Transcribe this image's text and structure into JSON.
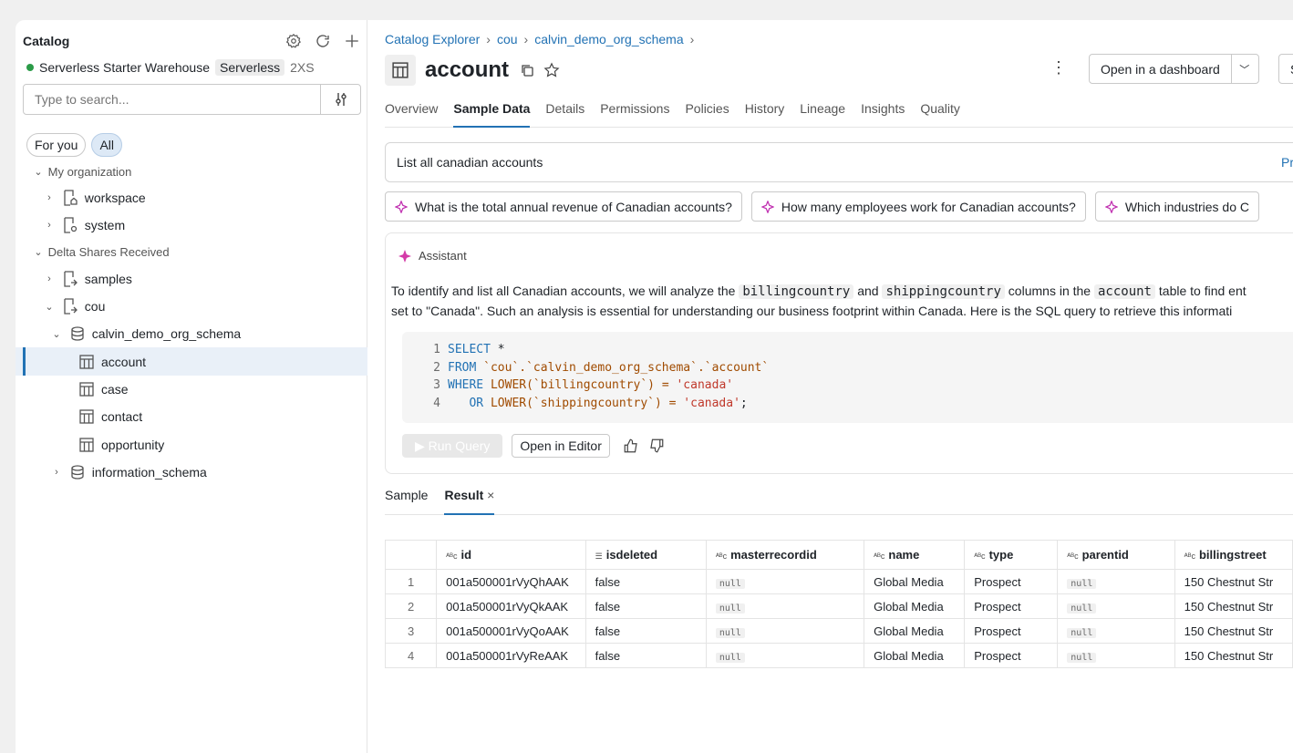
{
  "sidebar": {
    "title": "Catalog",
    "warehouse": {
      "name": "Serverless Starter Warehouse",
      "type_badge": "Serverless",
      "size": "2XS",
      "status_color": "#2b9b48"
    },
    "search_placeholder": "Type to search...",
    "filters": {
      "for_you": "For you",
      "all": "All"
    },
    "tree": {
      "my_org": "My organization",
      "workspace": "workspace",
      "system": "system",
      "delta_shares": "Delta Shares Received",
      "samples": "samples",
      "cou": "cou",
      "schema": "calvin_demo_org_schema",
      "account": "account",
      "case": "case",
      "contact": "contact",
      "opportunity": "opportunity",
      "information_schema": "information_schema"
    }
  },
  "breadcrumb": {
    "items": [
      "Catalog Explorer",
      "cou",
      "calvin_demo_org_schema"
    ],
    "sep": "›"
  },
  "header": {
    "title": "account",
    "dashboard_btn": "Open in a dashboard",
    "cut_btn": "S"
  },
  "tabs": [
    "Overview",
    "Sample Data",
    "Details",
    "Permissions",
    "Policies",
    "History",
    "Lineage",
    "Insights",
    "Quality"
  ],
  "prompt": {
    "text": "List all canadian accounts",
    "right_cut": "Pr"
  },
  "suggestions": [
    "What is the total annual revenue of Canadian accounts?",
    "How many employees work for Canadian accounts?",
    "Which industries do C"
  ],
  "assistant": {
    "label": "Assistant",
    "line1": {
      "a": "To identify and list all Canadian accounts, we will analyze the ",
      "code1": "billingcountry",
      "b": " and ",
      "code2": "shippingcountry",
      "c": " columns in the ",
      "code3": "account",
      "d": " table to find ent"
    },
    "line2": "set to \"Canada\". Such an analysis is essential for understanding our business footprint within Canada. Here is the SQL query to retrieve this informati",
    "code": {
      "l1": {
        "n": "1",
        "kw": "SELECT",
        "rest": " *"
      },
      "l2": {
        "n": "2",
        "kw": "FROM",
        "rest": " `cou`.`calvin_demo_org_schema`.`account`"
      },
      "l3": {
        "n": "3",
        "kw": "WHERE",
        "fn": " LOWER",
        "mid": "(`billingcountry`) = ",
        "str": "'canada'"
      },
      "l4": {
        "n": "4",
        "kw": "   OR",
        "fn": " LOWER",
        "mid": "(`shippingcountry`) = ",
        "str": "'canada'",
        "end": ";"
      }
    },
    "run_btn": "▶ Run Query",
    "editor_btn": "Open in Editor"
  },
  "result_tabs": {
    "sample": "Sample",
    "result": "Result"
  },
  "table": {
    "columns": [
      "id",
      "isdeleted",
      "masterrecordid",
      "name",
      "type",
      "parentid",
      "billingstreet"
    ],
    "rows": [
      {
        "n": "1",
        "id": "001a500001rVyQhAAK",
        "isdeleted": "false",
        "master": "null",
        "name": "Global Media",
        "type": "Prospect",
        "parent": "null",
        "street": "150 Chestnut Str"
      },
      {
        "n": "2",
        "id": "001a500001rVyQkAAK",
        "isdeleted": "false",
        "master": "null",
        "name": "Global Media",
        "type": "Prospect",
        "parent": "null",
        "street": "150 Chestnut Str"
      },
      {
        "n": "3",
        "id": "001a500001rVyQoAAK",
        "isdeleted": "false",
        "master": "null",
        "name": "Global Media",
        "type": "Prospect",
        "parent": "null",
        "street": "150 Chestnut Str"
      },
      {
        "n": "4",
        "id": "001a500001rVyReAAK",
        "isdeleted": "false",
        "master": "null",
        "name": "Global Media",
        "type": "Prospect",
        "parent": "null",
        "street": "150 Chestnut Str"
      }
    ]
  },
  "colors": {
    "accent": "#2272b4",
    "selected_bg": "#e9f0f8"
  }
}
